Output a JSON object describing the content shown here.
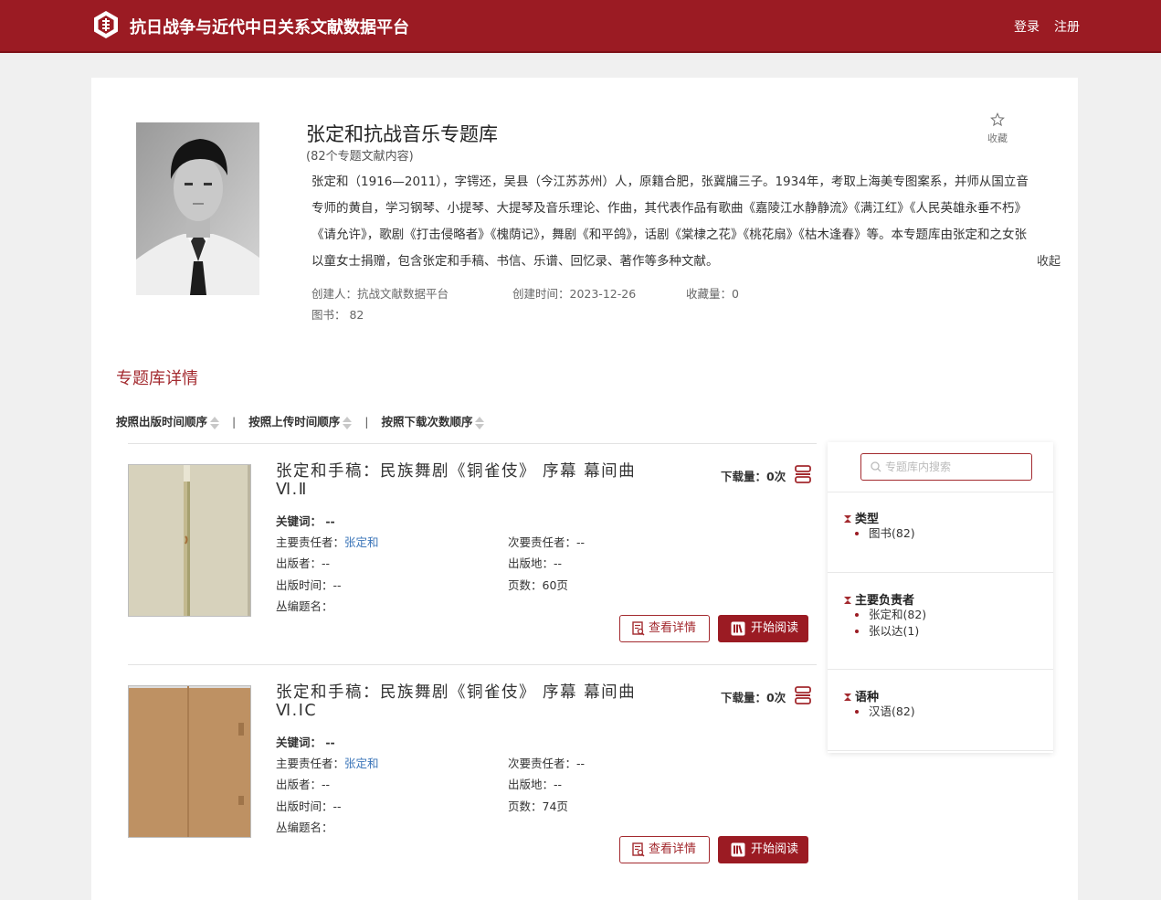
{
  "header": {
    "site_title": "抗日战争与近代中日关系文献数据平台",
    "login": "登录",
    "register": "注册"
  },
  "library": {
    "title": "张定和抗战音乐专题库",
    "subtitle": "(82个专题文献内容)",
    "favorite_label": "收藏",
    "description": "张定和（1916—2011），字锷还，吴县（今江苏苏州）人，原籍合肥，张冀牖三子。1934年，考取上海美专图案系，并师从国立音专师的黄自，学习钢琴、小提琴、大提琴及音乐理论、作曲，其代表作品有歌曲《嘉陵江水静静流》《满江红》《人民英雄永垂不朽》《请允许》，歌剧《打击侵略者》《槐荫记》，舞剧《和平鸽》，话剧《棠棣之花》《桃花扇》《枯木逢春》等。本专题库由张定和之女张以童女士捐赠，包含张定和手稿、书信、乐谱、回忆录、著作等多种文献。",
    "collapse": "收起",
    "creator": "创建人：抗战文献数据平台",
    "created_time": "创建时间：2023-12-26",
    "fav_count": "收藏量：0",
    "books": "图书：  82"
  },
  "section_title": "专题库详情",
  "sort": {
    "by_pub_time": "按照出版时间顺序",
    "by_upload_time": "按照上传时间顺序",
    "by_downloads": "按照下载次数顺序",
    "separator": "|"
  },
  "items": [
    {
      "title": "张定和手稿：民族舞剧《铜雀伎》 序幕 幕间曲 Ⅵ.Ⅱ",
      "download": "下载量：0次",
      "keywords": "关键词：  --",
      "primary_label": "主要责任者：",
      "primary_value": "张定和",
      "secondary": "次要责任者：--",
      "publisher": "出版者：--",
      "place": "出版地：--",
      "pub_time": "出版时间：--",
      "pages": "页数：60页",
      "series": "丛编题名：",
      "detail_btn": "查看详情",
      "read_btn": "开始阅读"
    },
    {
      "title": "张定和手稿：民族舞剧《铜雀伎》 序幕 幕间曲 Ⅵ.ⅠC",
      "download": "下载量：0次",
      "keywords": "关键词：  --",
      "primary_label": "主要责任者：",
      "primary_value": "张定和",
      "secondary": "次要责任者：--",
      "publisher": "出版者：--",
      "place": "出版地：--",
      "pub_time": "出版时间：--",
      "pages": "页数：74页",
      "series": "丛编题名：",
      "detail_btn": "查看详情",
      "read_btn": "开始阅读"
    }
  ],
  "sidebar": {
    "search_placeholder": "专题库内搜索",
    "facets": [
      {
        "title": "类型",
        "options": [
          "图书(82)"
        ]
      },
      {
        "title": "主要负责者",
        "options": [
          "张定和(82)",
          "张以达(1)"
        ]
      },
      {
        "title": "语种",
        "options": [
          "汉语(82)"
        ]
      }
    ]
  },
  "colors": {
    "brand": "#9b1b23",
    "accent_text": "#a32a2f",
    "link": "#3a74b8"
  }
}
